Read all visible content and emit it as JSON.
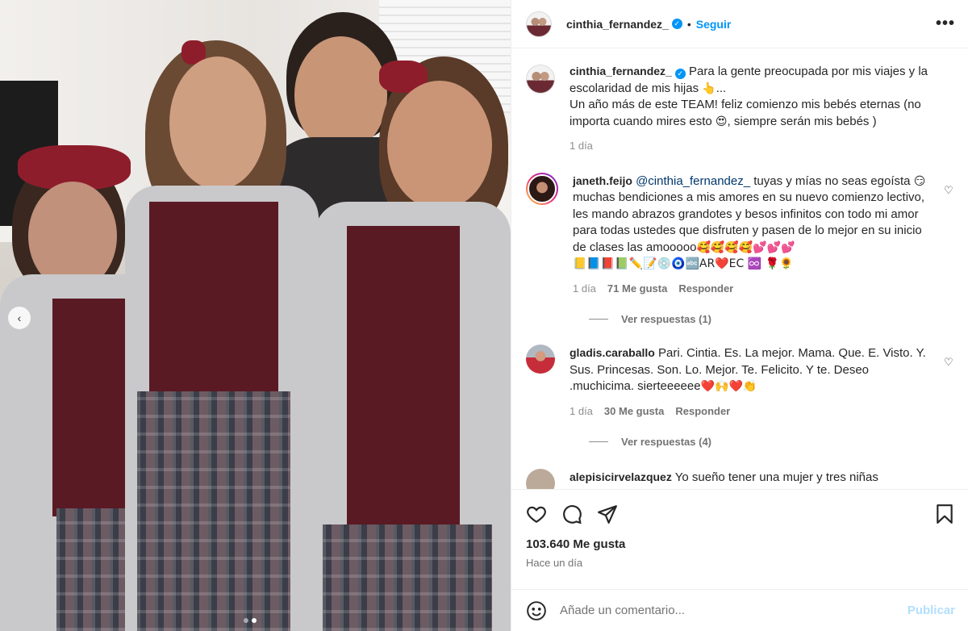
{
  "post": {
    "author": "cinthia_fernandez_",
    "follow_label": "Seguir",
    "bullet": "•",
    "more_label": "•••",
    "caption_line1": "Para la gente preocupada por mis viajes y la escolaridad de mis hijas",
    "caption_emoji1": "👆",
    "caption_ellipsis": "...",
    "caption_line2": "Un año más de este TEAM! feliz comienzo mis bebés eternas (no importa cuando mires esto",
    "caption_emoji2": "😍",
    "caption_line3": ", siempre serán mis bebés )",
    "caption_time": "1 día"
  },
  "comments": [
    {
      "user": "janeth.feijo",
      "mention": "@cinthia_fernandez_",
      "text1": " tuyas y mías no seas egoísta ",
      "emoji1": "😏",
      "text2": " muchas bendiciones a mis amores en su nuevo comienzo lectivo, les mando abrazos grandotes y besos infinitos con todo mi amor para todas ustedes que disfruten y pasen de lo mejor en su inicio de clases las amooooo",
      "emoji2": "🥰🥰🥰🥰💕💕💕",
      "emoji3": "📒📘📕📗✏️📝💿🧿🔤AR❤️EC ♾️ 🌹🌻",
      "time": "1 día",
      "likes": "71 Me gusta",
      "reply": "Responder",
      "view_replies": "Ver respuestas (1)"
    },
    {
      "user": "gladis.caraballo",
      "text1": "Pari. Cintia. Es. La mejor. Mama. Que. E. Visto. Y. Sus. Princesas. Son. Lo. Mejor. Te. Felicito. Y te. Deseo .muchicima. sierteeeeee",
      "emoji1": "❤️🙌❤️👏",
      "time": "1 día",
      "likes": "30 Me gusta",
      "reply": "Responder",
      "view_replies": "Ver respuestas (4)"
    },
    {
      "user": "alepisicirvelazquez",
      "text1": "Yo sueño tener una mujer y tres niñas"
    }
  ],
  "actions": {
    "likes_count": "103.640 Me gusta",
    "posted_ago": "Hace un día"
  },
  "composer": {
    "placeholder": "Añade un comentario...",
    "publish_label": "Publicar"
  },
  "carousel": {
    "prev_icon": "‹",
    "slide_count": 2,
    "active_slide": 2
  }
}
